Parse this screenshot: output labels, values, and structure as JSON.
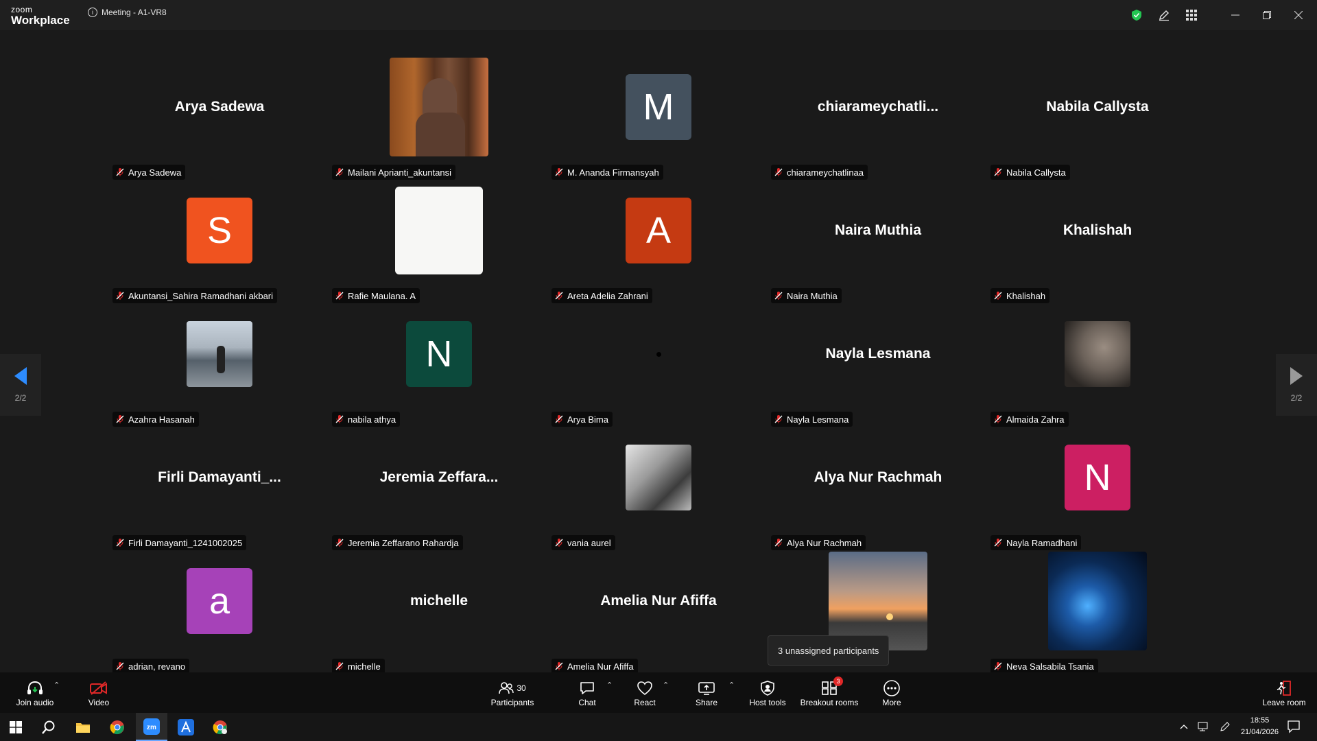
{
  "window": {
    "logo_line1": "zoom",
    "logo_line2": "Workplace",
    "meeting_title": "Meeting - A1-VR8",
    "info_icon": "i"
  },
  "pager": {
    "left_page": "2/2",
    "right_page": "2/2"
  },
  "tiles": [
    {
      "name": "Arya Sadewa",
      "display": "Arya Sadewa"
    },
    {
      "name": "Mailani Aprianti_akuntansi"
    },
    {
      "name": "M. Ananda Firmansyah",
      "initial": "M",
      "color": "#44515e"
    },
    {
      "name": "chiaramеychatlinaa",
      "display": "chiaramеychatli..."
    },
    {
      "name": "Nabila Callysta",
      "display": "Nabila Callysta"
    },
    {
      "name": "Akuntansi_Sahira Ramadhani akbari",
      "initial": "S",
      "color": "#f0531f"
    },
    {
      "name": "Rafie Maulana. A"
    },
    {
      "name": "Areta Adelia Zahrani",
      "initial": "A",
      "color": "#c53a12"
    },
    {
      "name": "Naira Muthia",
      "display": "Naira Muthia"
    },
    {
      "name": "Khalishah",
      "display": "Khalishah"
    },
    {
      "name": "Azahra Hasanah"
    },
    {
      "name": "nabila athya",
      "initial": "N",
      "color": "#0c4a3c"
    },
    {
      "name": "Arya Bima"
    },
    {
      "name": "Nayla Lesmana",
      "display": "Nayla Lesmana"
    },
    {
      "name": "Almaida Zahra"
    },
    {
      "name": "Firli Damayanti_1241002025",
      "display": "Firli  Damayanti_..."
    },
    {
      "name": "Jeremia Zeffarano Rahardja",
      "display": "Jeremia  Zeffara..."
    },
    {
      "name": "vania aurel"
    },
    {
      "name": "Alya Nur Rachmah",
      "display": "Alya Nur Rachmah"
    },
    {
      "name": "Nayla Ramadhani",
      "initial": "N",
      "color": "#cc1f62"
    },
    {
      "name": "adrian, revano",
      "initial": "a",
      "color": "#a642b8"
    },
    {
      "name": "michelle",
      "display": "michelle"
    },
    {
      "name": "Amelia Nur Afiffa",
      "display": "Amelia Nur Afiffa"
    },
    {
      "name": ""
    },
    {
      "name": "Neva Salsabila Tsania"
    }
  ],
  "tooltip": "3 unassigned participants",
  "toolbar": {
    "join_audio": "Join audio",
    "video": "Video",
    "participants": "Participants",
    "participants_count": "30",
    "chat": "Chat",
    "react": "React",
    "share": "Share",
    "host_tools": "Host tools",
    "breakout_rooms": "Breakout rooms",
    "breakout_badge": "3",
    "more": "More",
    "leave_room": "Leave room"
  },
  "taskbar": {
    "time": "18:55",
    "date": "21/04/2026"
  },
  "colors": {
    "accent": "#2d8cff",
    "mic_off": "#e02828",
    "shield": "#23c552"
  }
}
